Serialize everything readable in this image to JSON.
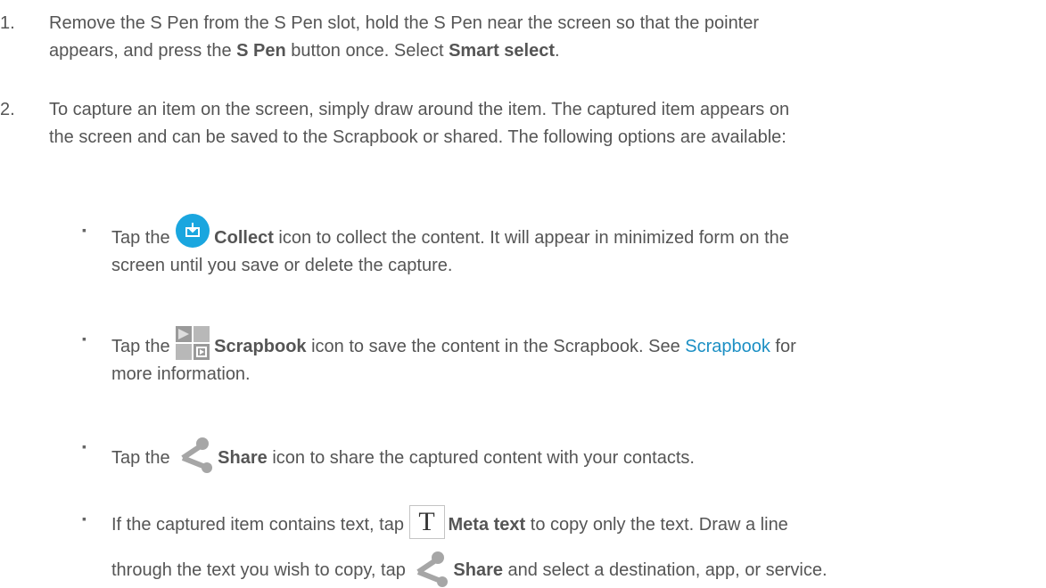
{
  "steps": [
    {
      "number": "1.",
      "line1_a": "Remove the S Pen from the S Pen slot, hold the S Pen near the screen so that the pointer",
      "line2_a": "appears, and press the ",
      "line2_b": "S Pen",
      "line2_c": " button once. Select ",
      "line2_d": "Smart select",
      "line2_e": "."
    },
    {
      "number": "2.",
      "line1": "To capture an item on the screen, simply draw around the item. The captured item appears on",
      "line2": "the screen and can be saved to the Scrapbook or shared. The following options are available:"
    }
  ],
  "bullets": [
    {
      "marker": "▪",
      "icon": "collect-icon",
      "pre": "Tap the ",
      "bold": "Collect",
      "post": " icon to collect the content. It will appear in minimized form on the",
      "line2": "screen until you save or delete the capture."
    },
    {
      "marker": "▪",
      "icon": "scrapbook-icon",
      "pre": "Tap the ",
      "bold": "Scrapbook",
      "post": " icon to save the content in the Scrapbook. See ",
      "link": "Scrapbook",
      "post2": " for",
      "line2": "more information."
    },
    {
      "marker": "▪",
      "icon": "share-icon",
      "pre": "Tap the ",
      "bold": "Share",
      "post": " icon to share the captured content with your contacts."
    },
    {
      "marker": "▪",
      "icon": "meta-text-icon",
      "icon_glyph": "T",
      "pre": "If the captured item contains text, tap ",
      "bold": "Meta text",
      "post": " to copy only the text. Draw a line",
      "line2_pre": "through the text you wish to copy, tap ",
      "line2_icon": "share-icon",
      "line2_bold": "Share",
      "line2_post": " and select a destination, app, or service."
    }
  ],
  "colors": {
    "text": "#555555",
    "link": "#1b8fc4",
    "collect_icon": "#1aa6df",
    "icon_gray": "#a6a6a6"
  }
}
